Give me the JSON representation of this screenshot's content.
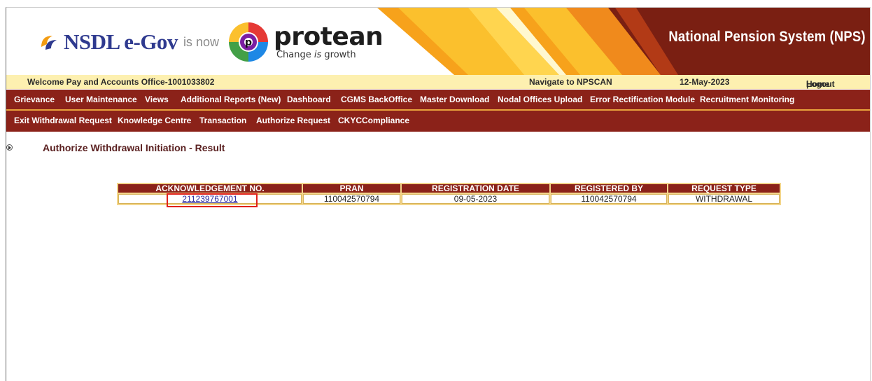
{
  "banner": {
    "nsdl_brand": "NSDL e-Gov",
    "is_now": "is now",
    "protean_brand": "protean",
    "protean_tagline_pre": "Change ",
    "protean_tagline_em": "is",
    "protean_tagline_post": " growth",
    "system_title": "National Pension System (NPS)"
  },
  "welcome_bar": {
    "welcome_text": "Welcome Pay and Accounts Office-1001033802",
    "navigate_text": "Navigate to NPSCAN",
    "date": "12-May-2023",
    "home_link": "Home",
    "separator": " | ",
    "logout_link": "Logout"
  },
  "menu_row1": [
    "Grievance",
    "User Maintenance",
    "Views",
    "Additional Reports (New)",
    "Dashboard",
    "CGMS BackOffice",
    "Master Download",
    "Nodal Offices Upload",
    "Error Rectification Module",
    "Recruitment Monitoring"
  ],
  "menu_row2": [
    "Exit Withdrawal Request",
    "Knowledge Centre",
    "Transaction",
    "Authorize Request",
    "CKYCCompliance"
  ],
  "page": {
    "title": "Authorize Withdrawal Initiation - Result"
  },
  "result_table": {
    "headers": [
      "ACKNOWLEDGEMENT NO.",
      "PRAN",
      "REGISTRATION DATE",
      "REGISTERED BY",
      "REQUEST TYPE"
    ],
    "rows": [
      [
        "211239767001",
        "110042570794",
        "09-05-2023",
        "110042570794",
        "WITHDRAWAL"
      ]
    ]
  },
  "colors": {
    "menu_bg": "#8b2219",
    "welcome_bg": "#fdf0b0",
    "highlight_box": "#e0201a"
  }
}
